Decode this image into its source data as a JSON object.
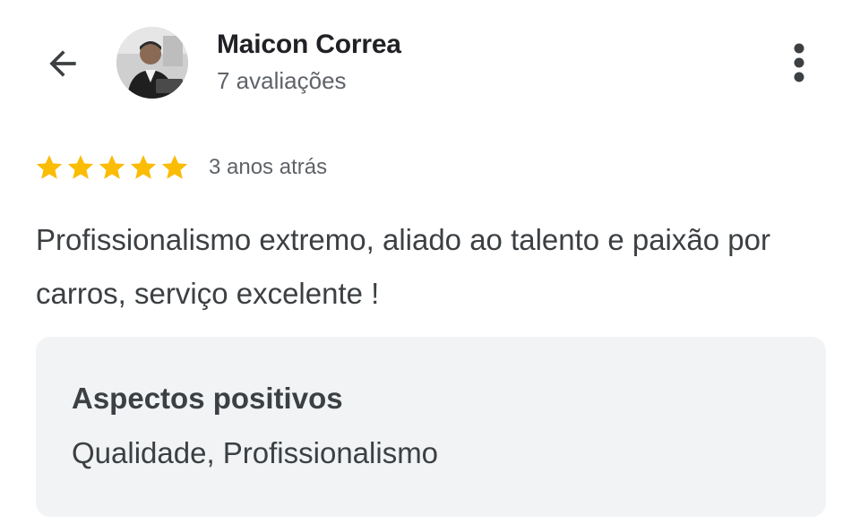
{
  "header": {
    "back_icon": "arrow-left-icon",
    "reviewer_name": "Maicon Correa",
    "review_count": "7 avaliações",
    "more_icon": "more-vert-icon"
  },
  "review": {
    "rating": 5,
    "max_rating": 5,
    "star_color": "#fbbc04",
    "date": "3 anos atrás",
    "text": "Profissionalismo extremo, aliado ao talento e paixão por carros, serviço excelente !"
  },
  "aspects": {
    "title": "Aspectos positivos",
    "values": "Qualidade, Profissionalismo"
  }
}
